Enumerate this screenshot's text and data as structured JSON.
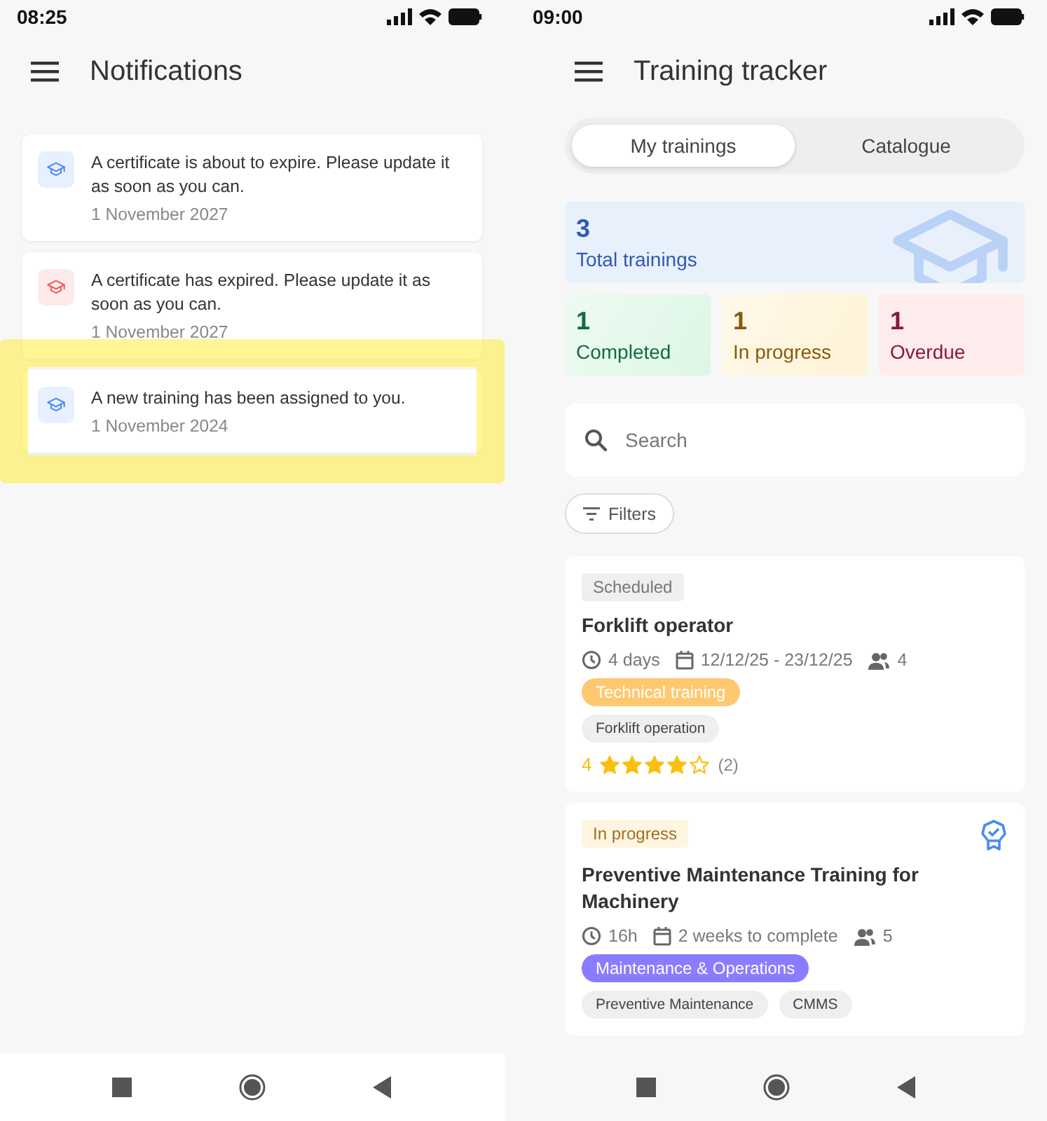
{
  "screens": [
    {
      "kind": "notifications",
      "status_bar": {
        "time": "08:25"
      },
      "title": "Notifications",
      "notifications": [
        {
          "kind": "info",
          "text": "A certificate is about to expire. Please update it as soon as you can.",
          "date": "1 November 2027",
          "highlighted": false
        },
        {
          "kind": "alert",
          "text": "A certificate has expired. Please update it as soon as you can.",
          "date": "1 November 2027",
          "highlighted": false
        },
        {
          "kind": "info",
          "text": "A new training has been assigned to you.",
          "date": "1 November 2024",
          "highlighted": true
        }
      ]
    },
    {
      "kind": "tracker",
      "status_bar": {
        "time": "09:00"
      },
      "title": "Training tracker",
      "tabs": [
        {
          "label": "My trainings",
          "selected": true
        },
        {
          "label": "Catalogue",
          "selected": false
        }
      ],
      "stats": [
        {
          "kind": "total",
          "value": "3",
          "label": "Total trainings"
        },
        {
          "kind": "completed",
          "value": "1",
          "label": "Completed"
        },
        {
          "kind": "in_progress",
          "value": "1",
          "label": "In progress"
        },
        {
          "kind": "overdue",
          "value": "1",
          "label": "Overdue"
        }
      ],
      "search": {
        "placeholder": "Search"
      },
      "filters_button": "Filters",
      "trainings": [
        {
          "status": {
            "kind": "scheduled",
            "label": "Scheduled"
          },
          "title": "Forklift operator",
          "certified": false,
          "duration": "4 days",
          "dates": "12/12/25 - 23/12/25",
          "participants": "4",
          "category": {
            "label": "Technical training",
            "color": "#ffc870"
          },
          "skills": [
            "Forklift operation"
          ],
          "rating": "4",
          "stars": 4,
          "reviews": "(2)"
        },
        {
          "status": {
            "kind": "in_progress",
            "label": "In progress"
          },
          "title": "Preventive Maintenance Training for Machinery",
          "certified": true,
          "duration": "16h",
          "dates": "2 weeks to complete",
          "participants": "5",
          "category": {
            "label": "Maintenance & Operations",
            "color": "#8b7cff"
          },
          "skills": [
            "Preventive Maintenance",
            "CMMS"
          ]
        }
      ]
    }
  ]
}
